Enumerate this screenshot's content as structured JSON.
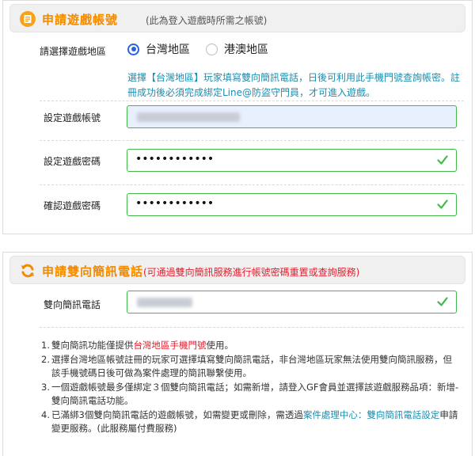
{
  "account_section": {
    "title": "申請遊戲帳號",
    "note": "(此為登入遊戲時所需之帳號)",
    "region_label": "請選擇遊戲地區",
    "regions": [
      {
        "label": "台灣地區",
        "selected": true
      },
      {
        "label": "港澳地區",
        "selected": false
      }
    ],
    "hint": "選擇【台灣地區】玩家填寫雙向簡訊電話，日後可利用此手機門號查詢帳密。註冊成功後必須完成綁定Line@防盜守門員，才可進入遊戲。",
    "account_label": "設定遊戲帳號",
    "password_label": "設定遊戲密碼",
    "password_value": "••••••••••••",
    "confirm_label": "確認遊戲密碼",
    "confirm_value": "••••••••••••"
  },
  "sms_section": {
    "title": "申請雙向簡訊電話",
    "note": "(可通過雙向簡訊服務進行帳號密碼重置或查詢服務)",
    "phone_label": "雙向簡訊電話",
    "notes": [
      {
        "num": "1.",
        "pre": "雙向簡訊功能僅提供",
        "red": "台灣地區手機門號",
        "post": "使用。"
      },
      {
        "num": "2.",
        "pre": "選擇台灣地區帳號註冊的玩家可選擇填寫雙向簡訊電話，非台灣地區玩家無法使用雙向簡訊服務，但該手機號碼日後可做為案件處理的簡訊聯繫使用。"
      },
      {
        "num": "3.",
        "pre": "一個遊戲帳號最多僅綁定３個雙向簡訊電話；如需新增，請登入GF會員並選擇該遊戲服務品項：新增-雙向簡訊電話功能。"
      },
      {
        "num": "4.",
        "pre": "已滿綁3個雙向簡訊電話的遊戲帳號，如需變更或刪除，需透過",
        "link": "案件處理中心：雙向簡訊電話設定",
        "post": "申請變更服務。(此服務屬付費服務)"
      }
    ]
  },
  "colors": {
    "accent": "#f08a00",
    "valid": "#41b94a",
    "radio": "#2b62d9",
    "hint": "#1a8fb0",
    "alert": "#e0202f"
  },
  "icons": {
    "account_header": "document-list-icon",
    "sms_header": "refresh-arrows-icon",
    "valid": "check-icon"
  }
}
